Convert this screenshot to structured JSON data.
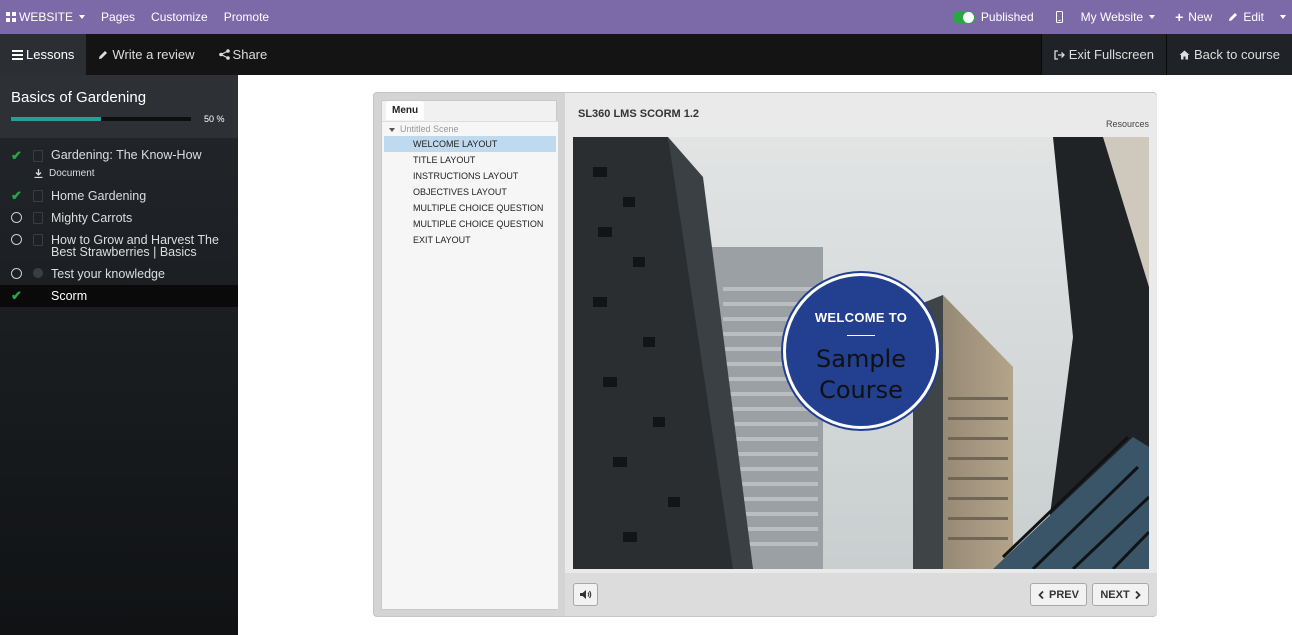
{
  "topbar": {
    "app_menu": "WEBSITE",
    "pages": "Pages",
    "customize": "Customize",
    "promote": "Promote",
    "published": "Published",
    "website_select": "My Website",
    "new": "New",
    "edit": "Edit"
  },
  "navbar": {
    "lessons": "Lessons",
    "write_review": "Write a review",
    "share": "Share",
    "exit_fullscreen": "Exit Fullscreen",
    "back_to_course": "Back to course"
  },
  "sidebar": {
    "course_title": "Basics of Gardening",
    "progress_percent": 50,
    "progress_label": "50 %",
    "lessons": [
      {
        "label": "Gardening: The Know-How",
        "status": "done",
        "type": "document"
      },
      {
        "label": "Home Gardening",
        "status": "done",
        "type": "infographic"
      },
      {
        "label": "Mighty Carrots",
        "status": "todo",
        "type": "infographic"
      },
      {
        "label": "How to Grow and Harvest The Best Strawberries | Basics",
        "status": "todo",
        "type": "document"
      },
      {
        "label": "Test your knowledge",
        "status": "todo",
        "type": "quiz"
      },
      {
        "label": "Scorm",
        "status": "done",
        "type": "scorm"
      }
    ],
    "attachment": "Document"
  },
  "player": {
    "menu_tab": "Menu",
    "scene": "Untitled Scene",
    "menu_items": [
      "WELCOME LAYOUT",
      "TITLE LAYOUT",
      "INSTRUCTIONS LAYOUT",
      "OBJECTIVES LAYOUT",
      "MULTIPLE CHOICE QUESTION",
      "MULTIPLE CHOICE QUESTION",
      "EXIT LAYOUT"
    ],
    "title": "SL360 LMS SCORM 1.2",
    "resources": "Resources",
    "welcome_to": "WELCOME TO",
    "course_line1": "Sample",
    "course_line2": "Course",
    "prev": "PREV",
    "next": "NEXT"
  },
  "colors": {
    "topbar": "#7c6aa8",
    "progress": "#1fa399",
    "check": "#28a745",
    "badge": "#233f8f",
    "menu_selected": "#bfd9ee"
  }
}
